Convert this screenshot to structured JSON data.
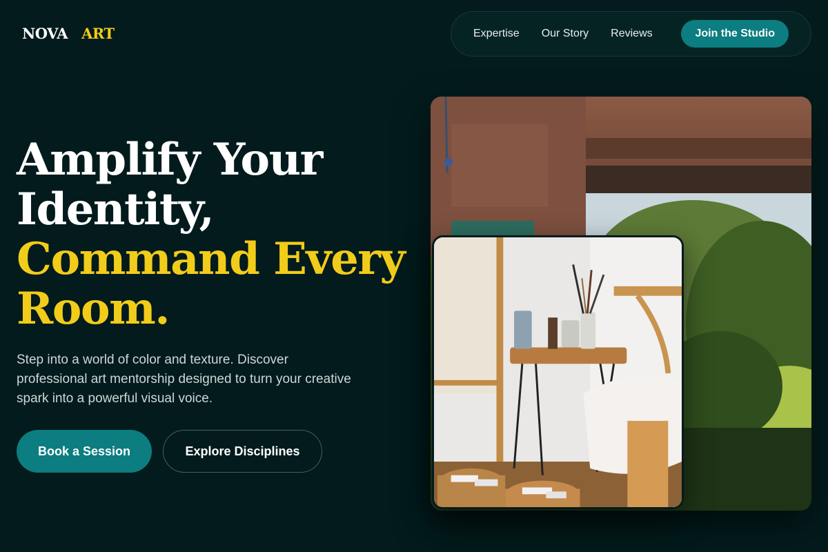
{
  "brand": {
    "word1": "NOVA",
    "word2": "ART"
  },
  "nav": {
    "links": [
      "Expertise",
      "Our Story",
      "Reviews"
    ],
    "cta": "Join the Studio"
  },
  "hero": {
    "title_white_1": "Amplify Your",
    "title_white_2": "Identity,",
    "title_gold_1": "Command Every",
    "title_gold_2": "Room.",
    "subtitle": "Step into a world of color and texture. Discover professional art mentorship designed to turn your creative spark into a powerful visual voice.",
    "primary_button": "Book a Session",
    "secondary_button": "Explore Disciplines"
  },
  "colors": {
    "background": "#031b1c",
    "accent_teal": "#0c7d80",
    "accent_gold": "#f2cc1a"
  }
}
